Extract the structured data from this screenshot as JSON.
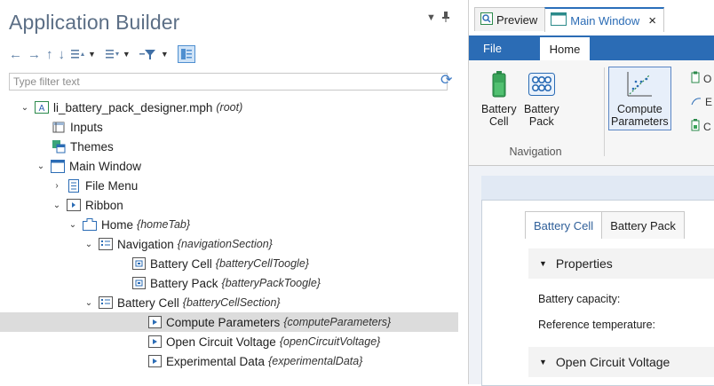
{
  "builder": {
    "title": "Application Builder",
    "filter_placeholder": "Type filter text"
  },
  "tree": [
    {
      "label": "li_battery_pack_designer.mph",
      "tag": "(root)"
    },
    {
      "label": "Inputs",
      "tag": ""
    },
    {
      "label": "Themes",
      "tag": ""
    },
    {
      "label": "Main Window",
      "tag": ""
    },
    {
      "label": "File Menu",
      "tag": ""
    },
    {
      "label": "Ribbon",
      "tag": ""
    },
    {
      "label": "Home",
      "tag": "{homeTab}"
    },
    {
      "label": "Navigation",
      "tag": "{navigationSection}"
    },
    {
      "label": "Battery Cell",
      "tag": "{batteryCellToogle}"
    },
    {
      "label": "Battery Pack",
      "tag": "{batteryPackToogle}"
    },
    {
      "label": "Battery Cell",
      "tag": "{batteryCellSection}"
    },
    {
      "label": "Compute Parameters",
      "tag": "{computeParameters}"
    },
    {
      "label": "Open Circuit Voltage",
      "tag": "{openCircuitVoltage}"
    },
    {
      "label": "Experimental Data",
      "tag": "{experimentalData}"
    }
  ],
  "editor_tabs": {
    "preview": "Preview",
    "main_window": "Main Window",
    "close": "×"
  },
  "ribbon": {
    "file_tab": "File",
    "home_tab": "Home",
    "battery_cell_l1": "Battery",
    "battery_cell_l2": "Cell",
    "battery_pack_l1": "Battery",
    "battery_pack_l2": "Pack",
    "compute_l1": "Compute",
    "compute_l2": "Parameters",
    "section_label": "Navigation",
    "side_items": [
      "O",
      "E",
      "C"
    ]
  },
  "form": {
    "tab_battery_cell": "Battery Cell",
    "tab_battery_pack": "Battery Pack",
    "section_properties": "Properties",
    "battery_capacity": "Battery capacity:",
    "reference_temperature": "Reference temperature:",
    "section_ocv": "Open Circuit Voltage"
  },
  "colors": {
    "accent": "#2b6cb5",
    "title": "#5c6f86",
    "selected_row": "#dcdcdc"
  }
}
